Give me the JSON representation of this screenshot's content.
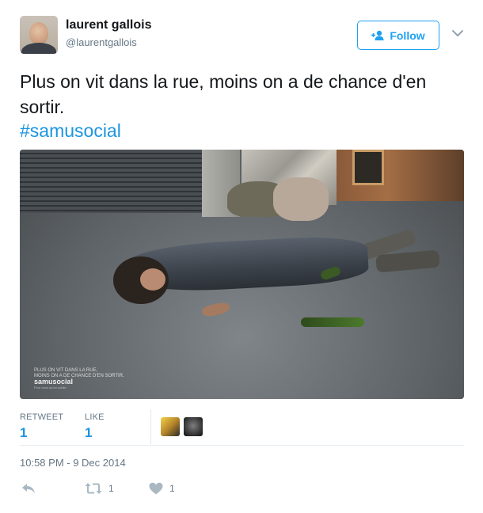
{
  "user": {
    "name": "laurent gallois",
    "handle": "@laurentgallois"
  },
  "follow_button": {
    "label": "Follow"
  },
  "tweet": {
    "text": "Plus on vit dans la rue, moins on a de chance d'en sortir.",
    "hashtag": "#samusocial"
  },
  "photo": {
    "caption_line1": "PLUS ON VIT DANS LA RUE,",
    "caption_line2": "MOINS ON A DE CHANCE D'EN SORTIR.",
    "brand": "samusocial",
    "tagline": "Pour ceux qu'on oublie"
  },
  "stats": {
    "retweet_label": "RETWEET",
    "retweet_count": "1",
    "like_label": "LIKE",
    "like_count": "1"
  },
  "timestamp": "10:58 PM - 9 Dec 2014",
  "actions": {
    "retweet_count": "1",
    "like_count": "1"
  },
  "colors": {
    "accent": "#1da1f2",
    "link": "#1b95e0",
    "muted": "#657786",
    "icon": "#aab8c2"
  }
}
